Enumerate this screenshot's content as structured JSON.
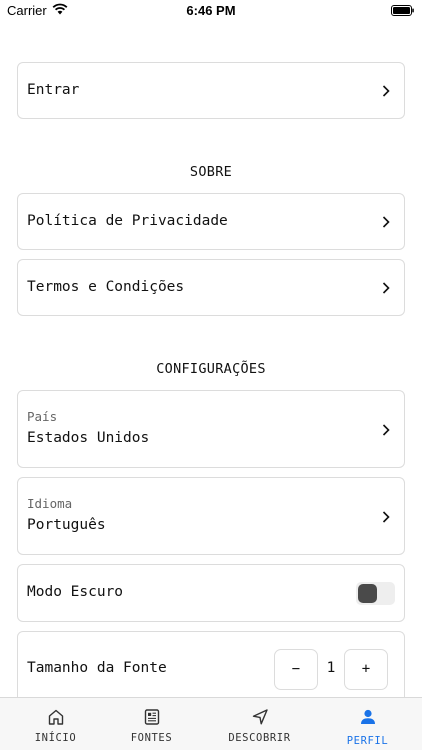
{
  "status_bar": {
    "carrier": "Carrier",
    "time": "6:46 PM"
  },
  "account": {
    "login_label": "Entrar"
  },
  "about": {
    "title": "SOBRE",
    "privacy_label": "Política de Privacidade",
    "terms_label": "Termos e Condições"
  },
  "settings": {
    "title": "CONFIGURAÇÕES",
    "country": {
      "label": "País",
      "value": "Estados Unidos"
    },
    "language": {
      "label": "Idioma",
      "value": "Português"
    },
    "dark_mode": {
      "label": "Modo Escuro",
      "enabled": false
    },
    "font_size": {
      "label": "Tamanho da Fonte",
      "decrement": "−",
      "increment": "+",
      "value": "1"
    }
  },
  "tab_bar": {
    "tabs": [
      {
        "label": "INÍCIO",
        "icon": "home-icon"
      },
      {
        "label": "FONTES",
        "icon": "newspaper-icon"
      },
      {
        "label": "DESCOBRIR",
        "icon": "navigation-arrow-icon"
      },
      {
        "label": "PERFIL",
        "icon": "person-icon"
      }
    ],
    "active_index": 3
  },
  "colors": {
    "accent": "#1a73e8",
    "border": "#dcdcdc",
    "tab_bar_bg": "#f7f7f7",
    "toggle_knob": "#4a4a4a"
  }
}
